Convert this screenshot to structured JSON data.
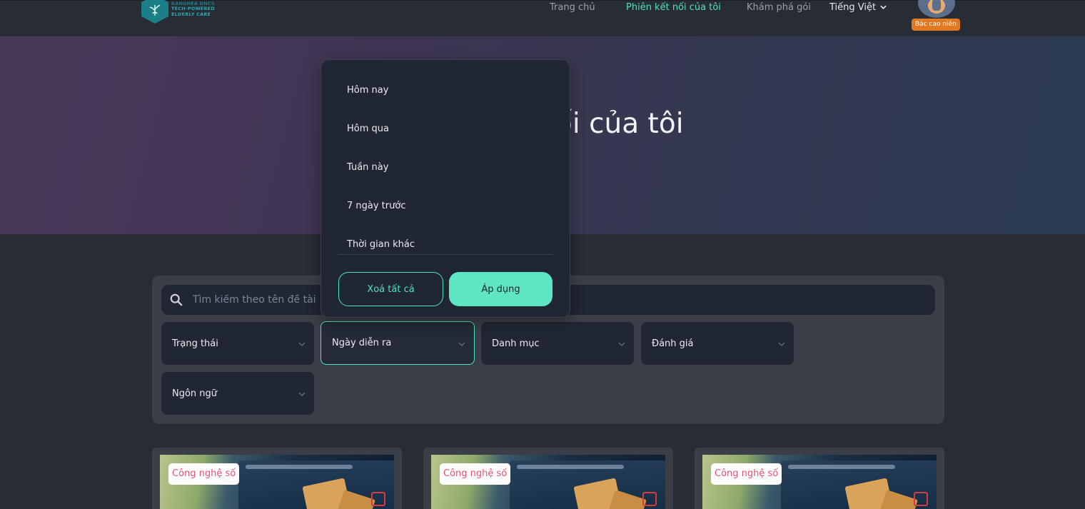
{
  "header": {
    "logo_text": [
      "KANGHEA DNCS",
      "TECH-POWERED",
      "ELDERLY CARE"
    ],
    "nav": {
      "home": "Trang chủ",
      "my_sessions": "Phiên kết nối của tôi",
      "explore": "Khám phá gói"
    },
    "language": "Tiếng Việt",
    "role_badge": "Bác cao niên"
  },
  "hero": {
    "title_visible": "ối của tôi"
  },
  "filters": {
    "search_placeholder": "Tìm kiếm theo tên đề tài",
    "status": "Trạng thái",
    "date": "Ngày diễn ra",
    "category": "Danh mục",
    "rating": "Đánh giá",
    "language": "Ngôn ngữ"
  },
  "date_dropdown": {
    "options": [
      "Hôm nay",
      "Hôm qua",
      "Tuần này",
      "7 ngày trước",
      "Thời gian khác"
    ],
    "clear_label": "Xoá tất cả",
    "apply_label": "Áp dụng"
  },
  "cards": [
    {
      "tag": "Công nghệ số"
    },
    {
      "tag": "Công nghệ số"
    },
    {
      "tag": "Công nghệ số"
    }
  ],
  "colors": {
    "accent": "#4fe3ba",
    "apply_button": "#5de6c1",
    "badge_orange": "#e37a22",
    "tag_text": "#e8506e",
    "panel": "#3a3f47",
    "input_bg": "#202634"
  },
  "icons": {
    "search": "search-icon",
    "chevron": "chevron-down-icon",
    "logo": "tree-logo-icon"
  }
}
